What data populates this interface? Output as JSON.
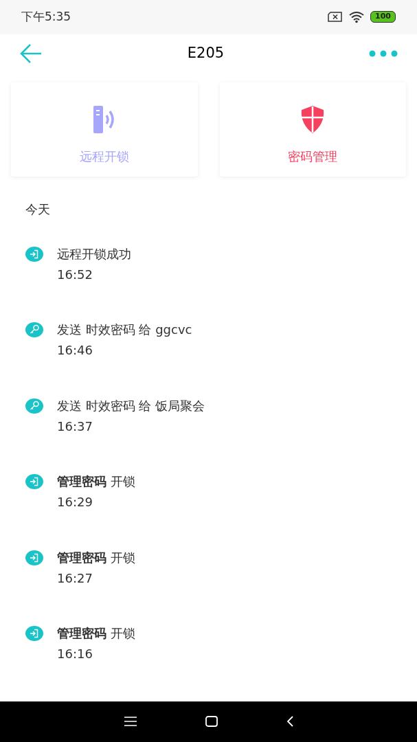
{
  "status_bar": {
    "time": "下午5:35",
    "battery": "100"
  },
  "header": {
    "title": "E205"
  },
  "actions": [
    {
      "kind": "remote",
      "label": "远程开锁",
      "color": "#a6a6fb"
    },
    {
      "kind": "password",
      "label": "密码管理",
      "color": "#f5415f"
    }
  ],
  "section": "今天",
  "log": [
    {
      "kind": "unlock",
      "text": "远程开锁成功",
      "time": "16:52"
    },
    {
      "kind": "key",
      "text": "发送 时效密码 给 ggcvc",
      "time": "16:46"
    },
    {
      "kind": "key",
      "text": "发送 时效密码 给 饭局聚会",
      "time": "16:37"
    },
    {
      "kind": "unlock",
      "text": "**管理密码** 开锁",
      "time": "16:29"
    },
    {
      "kind": "unlock",
      "text": "**管理密码** 开锁",
      "time": "16:27"
    },
    {
      "kind": "unlock",
      "text": "**管理密码** 开锁",
      "time": "16:16"
    }
  ]
}
